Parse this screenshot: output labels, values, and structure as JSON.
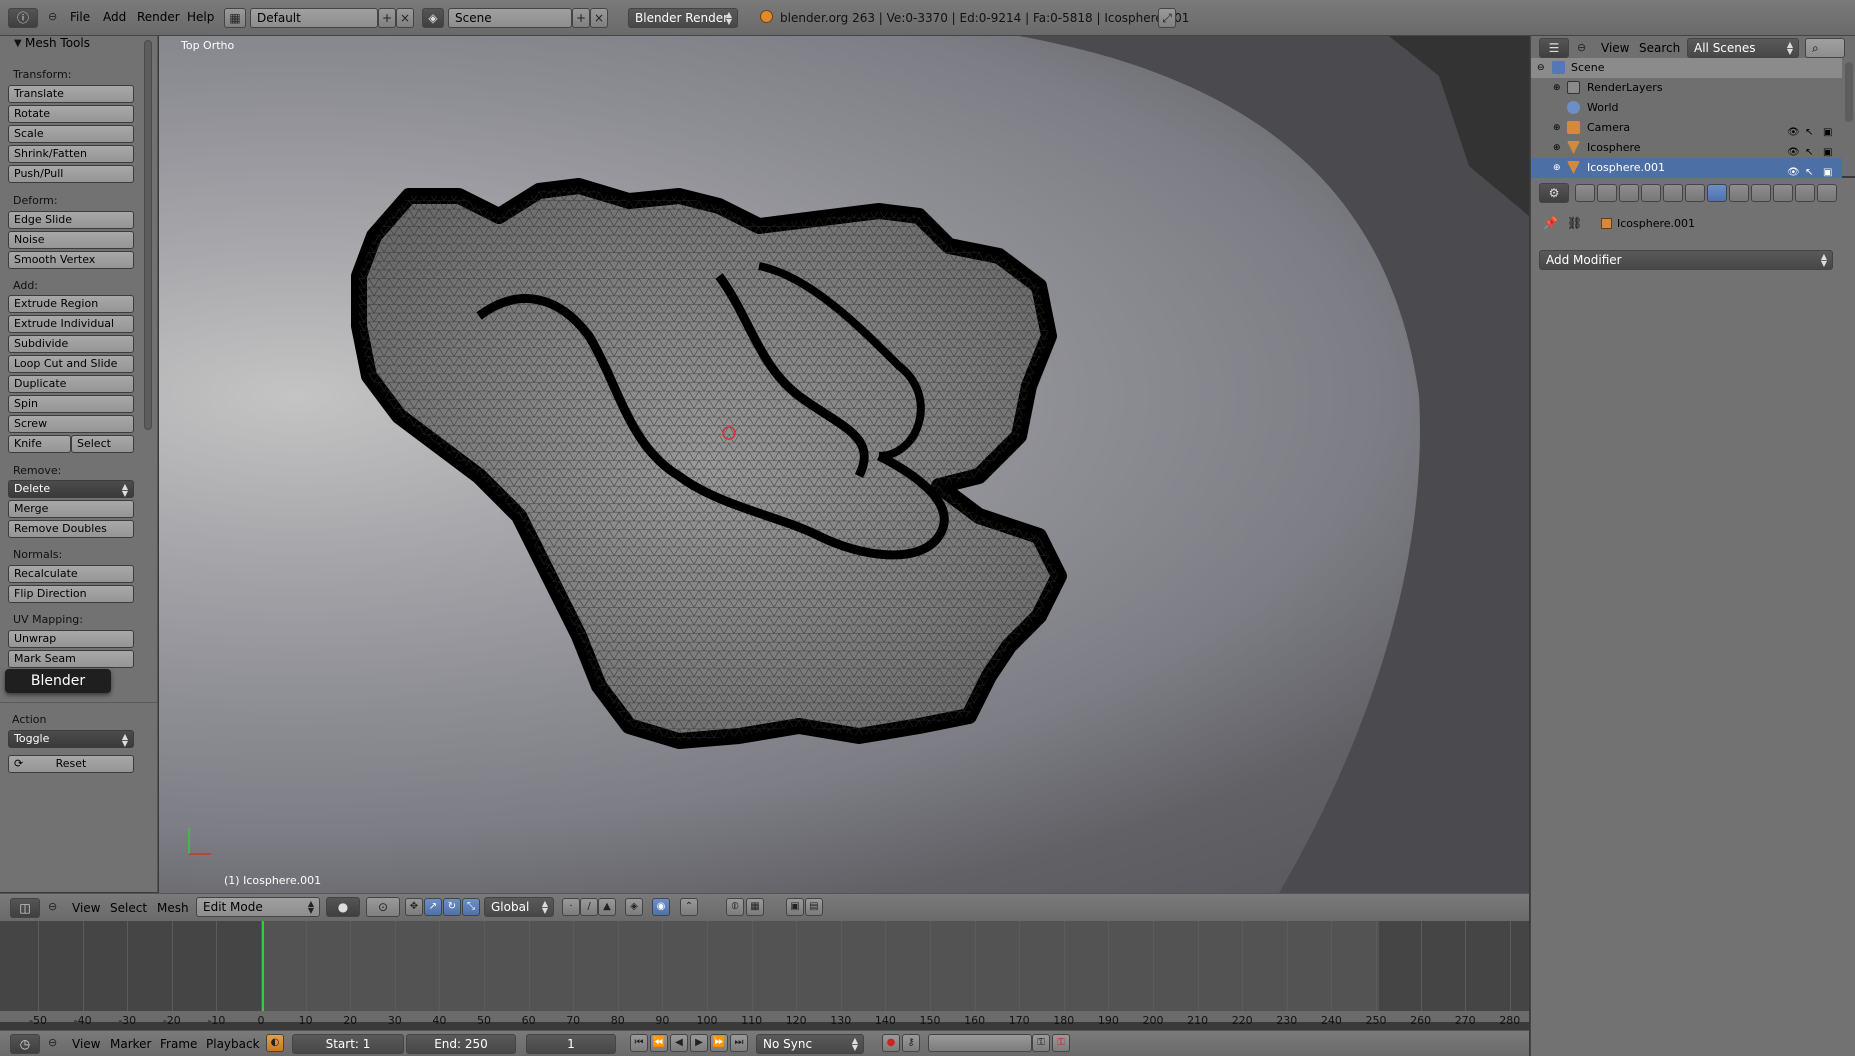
{
  "topbar": {
    "menus": [
      "File",
      "Add",
      "Render",
      "Help"
    ],
    "layout": "Default",
    "scene": "Scene",
    "engine": "Blender Render",
    "status": "blender.org 263 | Ve:0-3370 | Ed:0-9214 | Fa:0-5818 | Icosphere.001"
  },
  "toolshelf": {
    "title": "Mesh Tools",
    "sections": {
      "transform": "Transform:",
      "deform": "Deform:",
      "add": "Add:",
      "remove": "Remove:",
      "normals": "Normals:",
      "uv": "UV Mapping:"
    },
    "transform": [
      "Translate",
      "Rotate",
      "Scale",
      "Shrink/Fatten",
      "Push/Pull"
    ],
    "deform": [
      "Edge Slide",
      "Noise",
      "Smooth Vertex"
    ],
    "add": [
      "Extrude Region",
      "Extrude Individual",
      "Subdivide",
      "Loop Cut and Slide",
      "Duplicate",
      "Spin",
      "Screw"
    ],
    "knife": "Knife",
    "select": "Select",
    "delete": "Delete",
    "remove": [
      "Merge",
      "Remove Doubles"
    ],
    "normals": [
      "Recalculate",
      "Flip Direction"
    ],
    "uv": [
      "Unwrap",
      "Mark Seam"
    ],
    "tooltip": "Blender",
    "action_label": "Action",
    "action_value": "Toggle",
    "reset": "Reset"
  },
  "viewport": {
    "view_label": "Top Ortho",
    "object_label": "(1) Icosphere.001"
  },
  "vpheader": {
    "menus": [
      "View",
      "Select",
      "Mesh"
    ],
    "mode": "Edit Mode",
    "orientation": "Global"
  },
  "timeline": {
    "ticks": [
      "-50",
      "-40",
      "-30",
      "-20",
      "-10",
      "0",
      "10",
      "20",
      "30",
      "40",
      "50",
      "60",
      "70",
      "80",
      "90",
      "100",
      "110",
      "120",
      "130",
      "140",
      "150",
      "160",
      "170",
      "180",
      "190",
      "200",
      "210",
      "220",
      "230",
      "240",
      "250",
      "260",
      "270",
      "280"
    ],
    "menus": [
      "View",
      "Marker",
      "Frame",
      "Playback"
    ],
    "start": "Start: 1",
    "end": "End: 250",
    "current": "1",
    "sync": "No Sync"
  },
  "outliner": {
    "menus": [
      "View",
      "Search"
    ],
    "filter": "All Scenes",
    "rows": [
      "Scene",
      "RenderLayers",
      "World",
      "Camera",
      "Icosphere",
      "Icosphere.001"
    ]
  },
  "properties": {
    "object": "Icosphere.001",
    "add_modifier": "Add Modifier"
  },
  "colors": {
    "active_blue": "#4c6fa6",
    "timeline_cursor": "#3cc83c",
    "panel_bg": "#727272"
  }
}
